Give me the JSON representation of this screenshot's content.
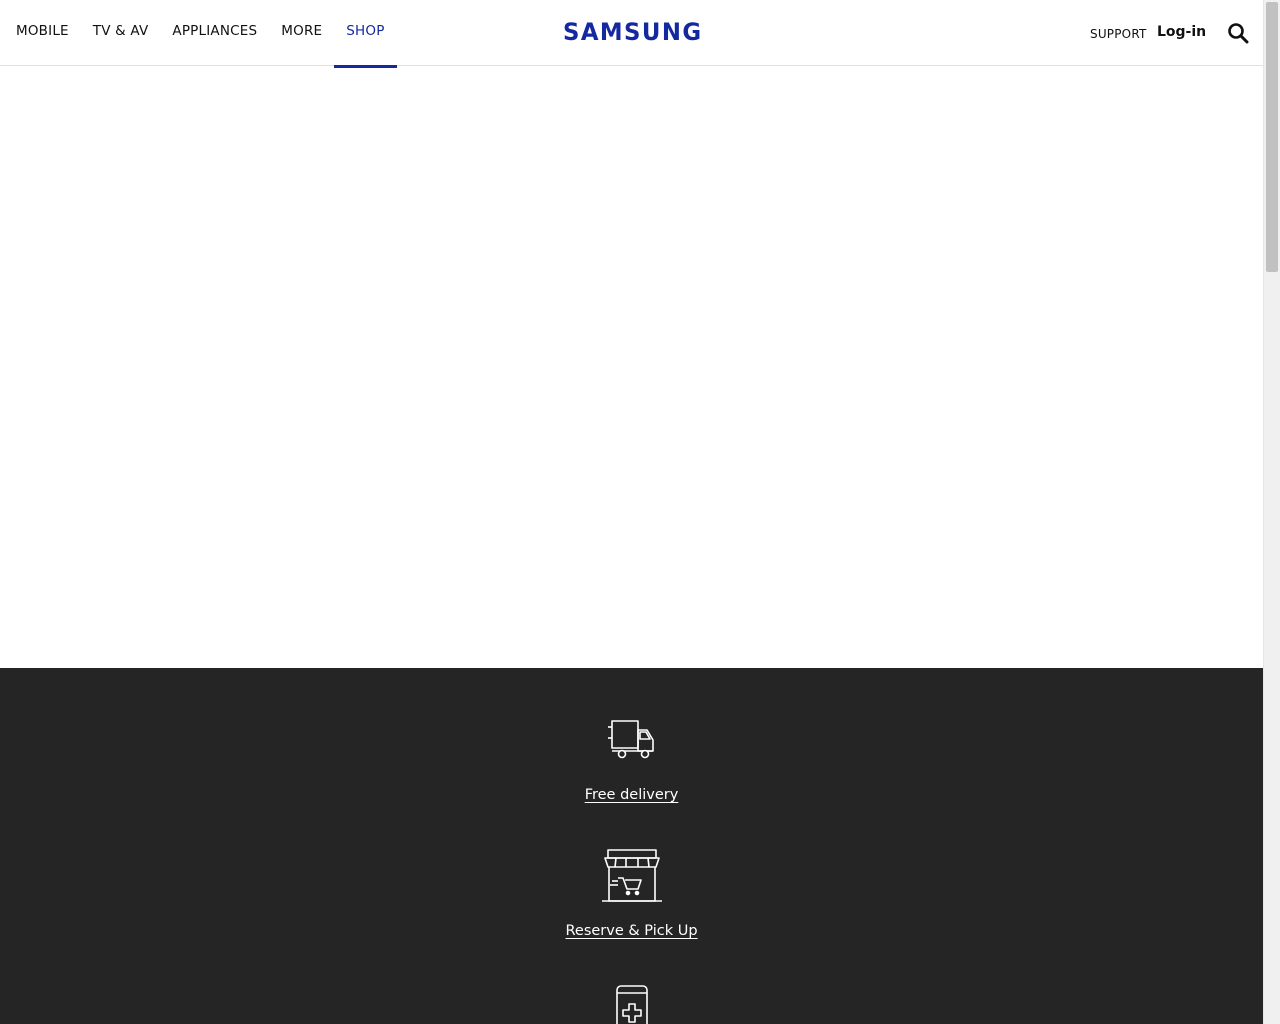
{
  "header": {
    "nav": [
      "MOBILE",
      "TV & AV",
      "APPLIANCES",
      "MORE",
      "SHOP"
    ],
    "active_nav": "SHOP",
    "logo": "SAMSUNG",
    "support": "SUPPORT",
    "login": "Log-in"
  },
  "services": [
    {
      "label": "Free delivery",
      "icon": "delivery-truck-icon"
    },
    {
      "label": "Reserve & Pick Up",
      "icon": "store-cart-icon"
    },
    {
      "label": "",
      "icon": "phone-repair-icon"
    }
  ],
  "colors": {
    "brand": "#1428a0",
    "footer_bg": "#252525",
    "text": "#111111"
  }
}
